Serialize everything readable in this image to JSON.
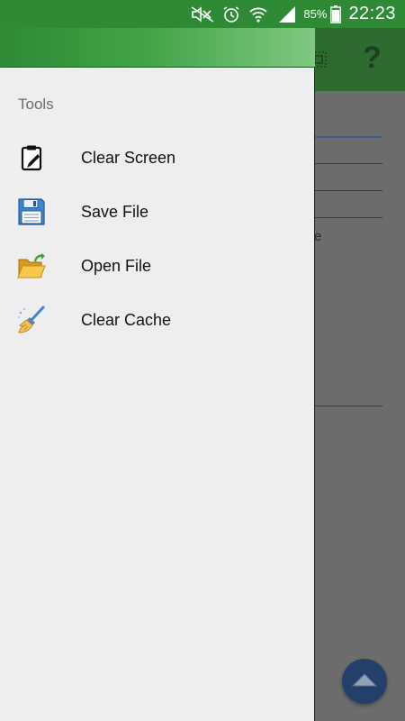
{
  "status_bar": {
    "battery_percent": "85%",
    "time": "22:23",
    "icons": [
      "mute-icon",
      "alarm-icon",
      "wifi-icon",
      "signal-icon",
      "battery-icon"
    ]
  },
  "background_app": {
    "toolbar_icons": [
      "grid-icon",
      "help-icon"
    ],
    "help_glyph": "?",
    "text_fragment": "e",
    "fab_icon": "arrow-up-icon"
  },
  "drawer": {
    "section_title": "Tools",
    "items": [
      {
        "label": "Clear Screen",
        "icon": "clipboard-clear-icon"
      },
      {
        "label": "Save File",
        "icon": "floppy-disk-icon"
      },
      {
        "label": "Open File",
        "icon": "open-folder-icon"
      },
      {
        "label": "Clear Cache",
        "icon": "broom-icon"
      }
    ]
  },
  "colors": {
    "status_bar": "#2f8a36",
    "drawer_bg": "#eeeeee",
    "drawer_header": "#41a346",
    "scrim": "#6e6e6e",
    "fab": "#22406a"
  }
}
